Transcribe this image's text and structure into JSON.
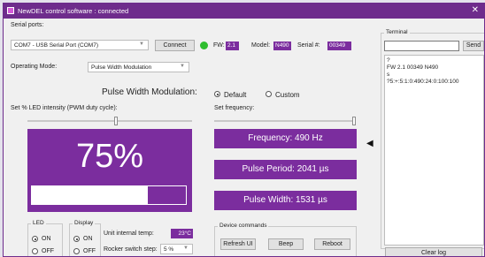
{
  "window": {
    "title": "NewDEL control software : connected",
    "close_glyph": "✕"
  },
  "serial": {
    "label": "Serial ports:",
    "port": "COM7 - USB Serial Port (COM7)",
    "connect": "Connect",
    "status_color": "#2ebd2e"
  },
  "device": {
    "fw_label": "FW:",
    "fw": "2.1",
    "model_label": "Model:",
    "model": "N490",
    "serial_label": "Serial #:",
    "serial": "00349"
  },
  "mode": {
    "label": "Operating Mode:",
    "value": "Pulse Width Modulation"
  },
  "pwm": {
    "title": "Pulse Width Modulation:",
    "intensity_label": "Set % LED intensity (PWM duty cycle):",
    "intensity_slider": 0.54,
    "percent": "75%",
    "bar_level": 0.75
  },
  "freq": {
    "option_default": "Default",
    "option_custom": "Custom",
    "selected": "default",
    "label": "Set frequency:",
    "slider": 1.0,
    "frequency": "Frequency: 490 Hz",
    "period": "Pulse Period: 2041 µs",
    "width": "Pulse Width: 1531 µs"
  },
  "led": {
    "title": "LED",
    "on": "ON",
    "off": "OFF",
    "selected": "on"
  },
  "display": {
    "title": "Display",
    "on": "ON",
    "off": "OFF",
    "selected": "on"
  },
  "unit": {
    "temp_label": "Unit internal temp:",
    "temp": "23°C",
    "rocker_label": "Rocker switch step:",
    "rocker": "5 %"
  },
  "commands": {
    "title": "Device commands",
    "refresh": "Refresh UI",
    "beep": "Beep",
    "reboot": "Reboot"
  },
  "terminal": {
    "title": "Terminal",
    "input": "",
    "send": "Send",
    "lines": [
      "?",
      "FW 2.1 00349 N490",
      "s",
      "?5:+:5:1:0:490:24:0:100:100"
    ],
    "clear": "Clear log"
  },
  "collapse_arrow": "◀",
  "colors": {
    "accent": "#7b2d9e",
    "title_bar": "#6e2c8c"
  }
}
